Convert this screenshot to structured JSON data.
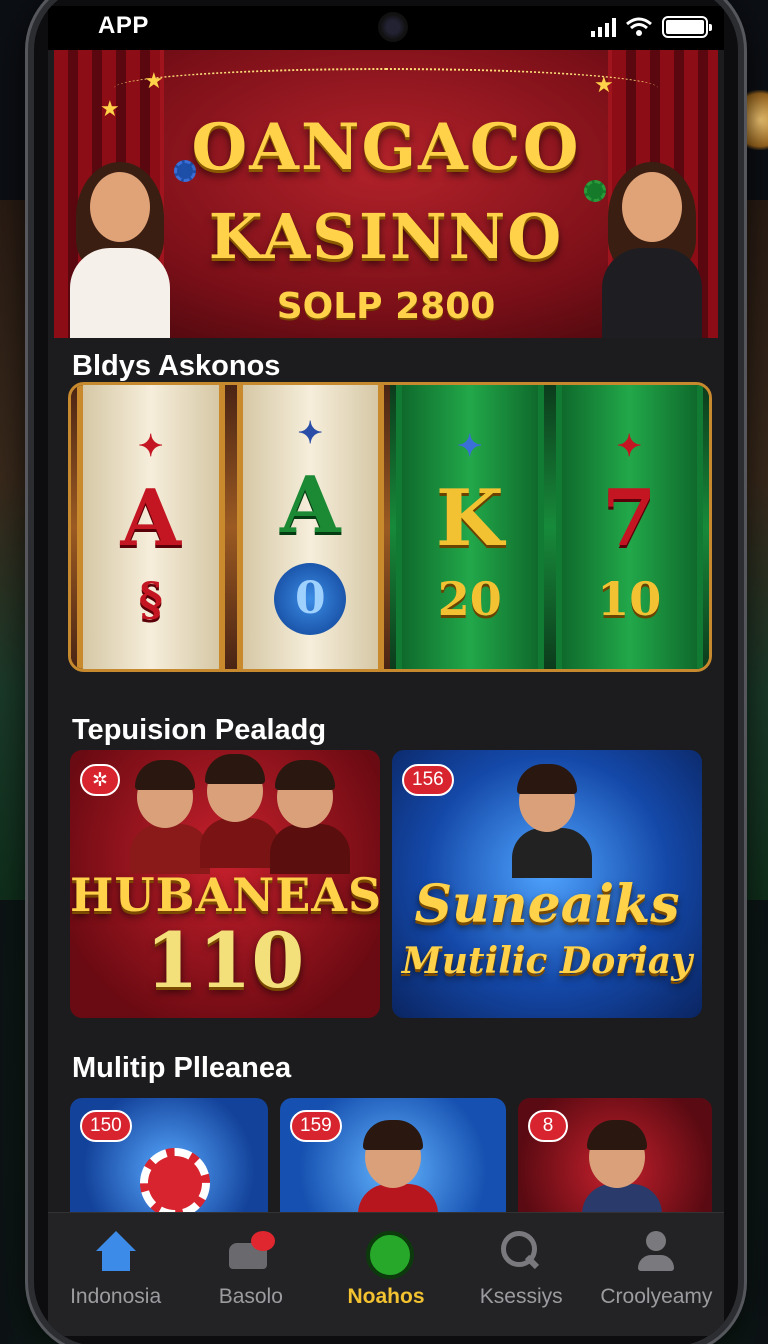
{
  "status_bar": {
    "time": "APP"
  },
  "hero": {
    "title_line1": "OANGACO",
    "title_line2": "KASINNO",
    "subtitle": "SOLP 2800"
  },
  "sections": {
    "slots_title": "Bldys Askonos",
    "featured_title": "Tepuision Pealadg",
    "multi_title": "Mulitip Plleanea"
  },
  "slot_banner": {
    "reels": [
      {
        "top": "A",
        "bottom": "§"
      },
      {
        "top": "A",
        "bottom": "0"
      },
      {
        "top": "K",
        "bottom": "20"
      },
      {
        "top": "7",
        "bottom": "10"
      }
    ]
  },
  "promos": [
    {
      "badge": "",
      "line1": "HUBANEAS",
      "line2": "110"
    },
    {
      "badge": "156",
      "line1": "Suneaiks",
      "line2": "Mutilic Doriay"
    }
  ],
  "mini_cards": [
    {
      "badge": "150"
    },
    {
      "badge": "159"
    },
    {
      "badge": "8"
    }
  ],
  "tabs": [
    {
      "label": "Indonosia",
      "icon": "home-icon"
    },
    {
      "label": "Basolo",
      "icon": "games-icon"
    },
    {
      "label": "Noahos",
      "icon": "live-icon"
    },
    {
      "label": "Ksessiys",
      "icon": "search-icon"
    },
    {
      "label": "Croolyeamy",
      "icon": "profile-icon"
    }
  ],
  "colors": {
    "accent_gold": "#f2c230",
    "tab_active_icon": "#27a82a",
    "home_blue": "#3d8be8",
    "badge_red": "#d8242e"
  }
}
